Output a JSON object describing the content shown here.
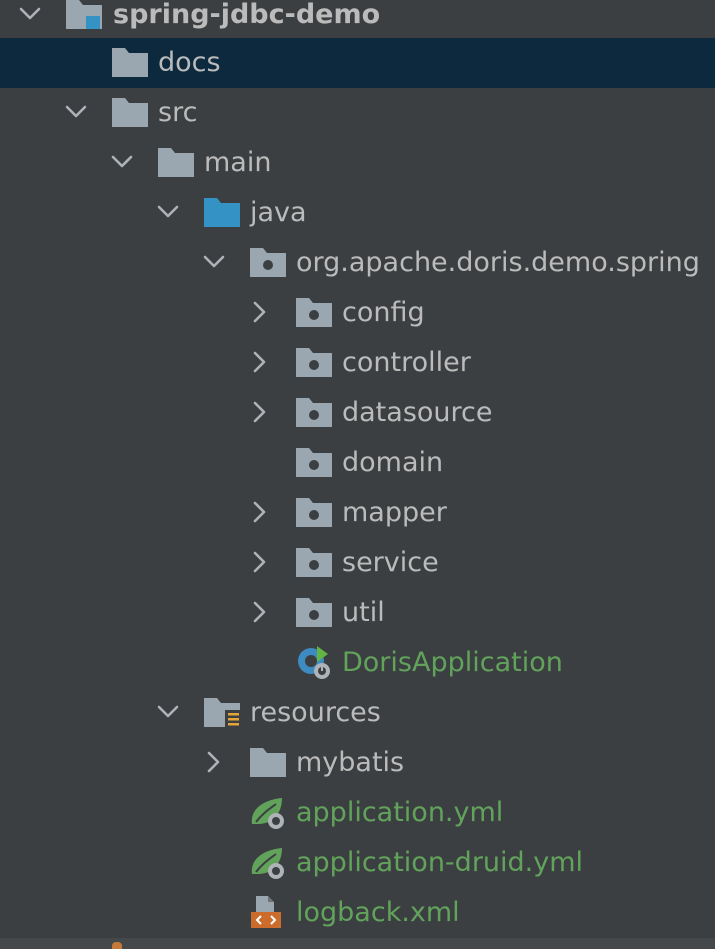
{
  "tree": {
    "project": {
      "label": "spring-jdbc-demo",
      "icon": "module-folder-icon"
    },
    "docs": {
      "label": "docs",
      "icon": "folder-icon"
    },
    "src": {
      "label": "src",
      "icon": "folder-icon"
    },
    "main": {
      "label": "main",
      "icon": "folder-icon"
    },
    "java": {
      "label": "java",
      "icon": "source-root-folder-icon"
    },
    "package": {
      "label": "org.apache.doris.demo.spring",
      "icon": "package-icon"
    },
    "config": {
      "label": "config",
      "icon": "package-icon"
    },
    "controller": {
      "label": "controller",
      "icon": "package-icon"
    },
    "datasource": {
      "label": "datasource",
      "icon": "package-icon"
    },
    "domain": {
      "label": "domain",
      "icon": "package-icon"
    },
    "mapper": {
      "label": "mapper",
      "icon": "package-icon"
    },
    "service": {
      "label": "service",
      "icon": "package-icon"
    },
    "util": {
      "label": "util",
      "icon": "package-icon"
    },
    "app_class": {
      "label": "DorisApplication",
      "icon": "spring-boot-class-icon"
    },
    "resources": {
      "label": "resources",
      "icon": "resources-root-folder-icon"
    },
    "mybatis": {
      "label": "mybatis",
      "icon": "folder-icon"
    },
    "application_yml": {
      "label": "application.yml",
      "icon": "spring-config-icon"
    },
    "application_druid_yml": {
      "label": "application-druid.yml",
      "icon": "spring-config-icon"
    },
    "logback_xml": {
      "label": "logback.xml",
      "icon": "xml-file-icon"
    }
  },
  "colors": {
    "background": "#3c3f41",
    "selected_row": "#0d293e",
    "text": "#bbbbbb",
    "spring_text": "#62a35c",
    "folder": "#9aa7b0",
    "source_root": "#3592c4"
  }
}
